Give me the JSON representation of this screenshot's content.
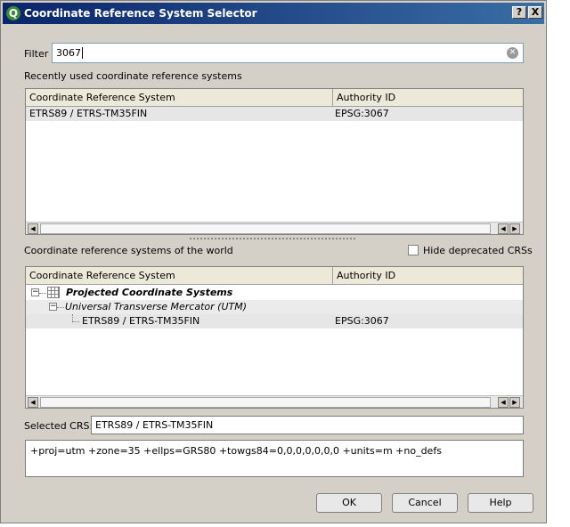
{
  "window": {
    "title": "Coordinate Reference System Selector",
    "help_glyph": "?",
    "close_glyph": "X",
    "app_glyph": "Q"
  },
  "filter": {
    "label": "Filter",
    "value": "3067",
    "clear_icon": "clear-icon"
  },
  "recent": {
    "label": "Recently used coordinate reference systems",
    "columns": [
      "Coordinate Reference System",
      "Authority ID"
    ],
    "rows": [
      {
        "crs": "ETRS89 / ETRS-TM35FIN",
        "authority": "EPSG:3067"
      }
    ]
  },
  "world": {
    "label": "Coordinate reference systems of the world",
    "hide_deprecated_label": "Hide deprecated CRSs",
    "hide_deprecated_checked": false,
    "columns": [
      "Coordinate Reference System",
      "Authority ID"
    ],
    "tree": {
      "group": "Projected Coordinate Systems",
      "subgroup": "Universal Transverse Mercator (UTM)",
      "item": {
        "crs": "ETRS89 / ETRS-TM35FIN",
        "authority": "EPSG:3067"
      }
    }
  },
  "selected": {
    "label": "Selected CRS:",
    "value": "ETRS89 / ETRS-TM35FIN"
  },
  "proj": {
    "text": "+proj=utm +zone=35 +ellps=GRS80 +towgs84=0,0,0,0,0,0,0 +units=m +no_defs"
  },
  "buttons": {
    "ok": "OK",
    "cancel": "Cancel",
    "help": "Help"
  }
}
